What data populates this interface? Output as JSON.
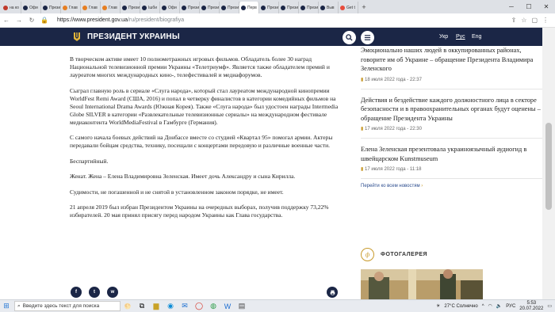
{
  "browser": {
    "tabs": [
      {
        "label": "на ко",
        "color": "#c0392b"
      },
      {
        "label": "Офи",
        "color": "#1b2646"
      },
      {
        "label": "Прези",
        "color": "#1b2646"
      },
      {
        "label": "Глав",
        "color": "#e67e22"
      },
      {
        "label": "Глав",
        "color": "#e67e22"
      },
      {
        "label": "Глав",
        "color": "#e67e22"
      },
      {
        "label": "Прези",
        "color": "#1b2646"
      },
      {
        "label": "Ішби",
        "color": "#1b2646"
      },
      {
        "label": "Офи",
        "color": "#1b2646"
      },
      {
        "label": "Прези",
        "color": "#1b2646"
      },
      {
        "label": "Прези",
        "color": "#1b2646"
      },
      {
        "label": "Прези",
        "color": "#1b2646"
      },
      {
        "label": "Перв",
        "color": "#1b2646",
        "active": true
      },
      {
        "label": "Прези",
        "color": "#1b2646"
      },
      {
        "label": "Прези",
        "color": "#1b2646"
      },
      {
        "label": "Прези",
        "color": "#1b2646"
      },
      {
        "label": "Выв",
        "color": "#1b2646"
      },
      {
        "label": "Get t",
        "color": "#e74c3c"
      }
    ],
    "new_tab": "+",
    "url_host": "https://www.president.gov.ua",
    "url_path": "/ru/president/biografiya"
  },
  "header": {
    "title": "ПРЕЗИДЕНТ УКРАИНЫ",
    "search_icon": "search-icon",
    "menu_icon": "menu-icon",
    "langs": [
      "Укр",
      "Рус",
      "Eng"
    ],
    "active_lang": "Рус"
  },
  "article": {
    "paragraphs": [
      "В творческом активе имеет 10 полнометражных игровых фильмов. Обладатель более 30 наград Национальной телевизионной премии Украины «Телетриумф». Является также обладателем премий и лауреатом многих международных кино-, телефестивалей и медиафорумов.",
      "Сыграл главную роль в сериале «Слуга народа», который стал лауреатом международной кинопремии WorldFest Remi Award (США, 2016) и попал в четверку финалистов в категории комедийных фильмов на Seoul International Drama Awards (Южная Корея). Также «Слуга народа» был удостоен награды Intermedia Globe SILVER в категории «Развлекательные телевизионные сериалы» на международном фестивале медиаконтента WorldMediaFestival в Гамбурге (Германия).",
      "С самого начала боевых действий на Донбассе вместе со студией «Квартал 95» помогал армии. Актеры передавали бойцам средства, технику, посещали с концертами передовую и различные военные части.",
      "Беспартийный.",
      "Женат. Жена – Елена Владимировна Зеленская. Имеет дочь Александру и сына Кирилла.",
      "Судимости, не погашенной и не снятой в установленном законом порядке, не имеет.",
      "21 апреля 2019 был избран Президентом Украины на очередных выборах, получив поддержку 73,22% избирателей. 20 мая принял присягу перед народом Украины как Глава государства."
    ]
  },
  "sidebar": {
    "news": [
      {
        "title": "Эмоционально наших людей в оккупированных районах, говорите им об Украине – обращение Президента Владимира Зеленского",
        "date": "18 июля 2022 года - 22:37"
      },
      {
        "title": "Действия и бездействие каждого должностного лица в секторе безопасности и в правоохранительных органах будут оценены – обращение Президента Украины",
        "date": "17 июля 2022 года - 22:30"
      },
      {
        "title": "Елена Зеленская презентовала украиноязычный аудиогид в швейцарском Kunstmuseum",
        "date": "17 июля 2022 года - 11:18"
      }
    ],
    "all_news": "Перейти ко всем новостям",
    "gallery_title": "ФОТОГАЛЕРЕЯ"
  },
  "share": {
    "facebook": "f",
    "twitter": "t",
    "whatsapp": "w",
    "print": "print-icon"
  },
  "taskbar": {
    "search_placeholder": "Введите здесь текст для поиска",
    "weather": "27°C Солнечно",
    "lang": "РУС",
    "time": "5:53",
    "date": "20.07.2022"
  }
}
